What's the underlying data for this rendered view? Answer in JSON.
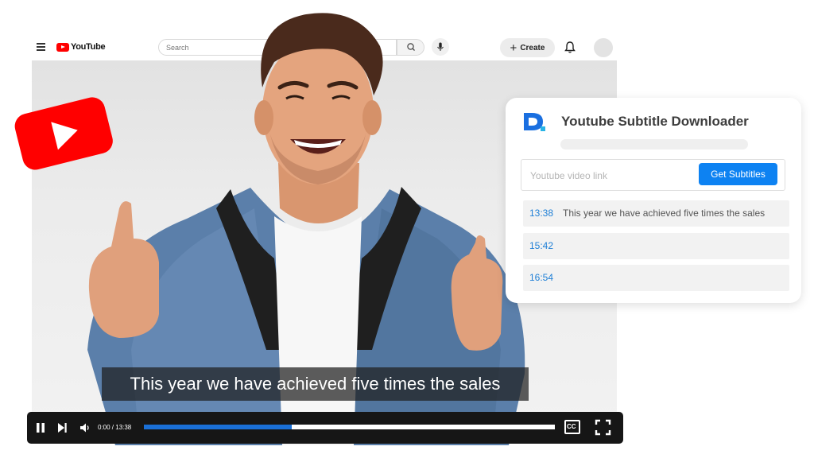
{
  "youtube": {
    "logo_text": "YouTube",
    "search": {
      "placeholder": "Search"
    },
    "create_label": "Create",
    "brand_red": "#ff0000"
  },
  "video": {
    "subtitle_text": "This year we have achieved five times the sales",
    "time": "0:00 / 13:38",
    "progress_fraction": 0.36,
    "controls": [
      "pause-icon",
      "next-icon",
      "volume-icon",
      "cc-icon",
      "fullscreen-icon"
    ],
    "cc_label": "CC"
  },
  "downloader": {
    "title": "Youtube Subtitle Downloader",
    "input_placeholder": "Youtube video link",
    "button_label": "Get Subtitles",
    "accent": "#0d82f2",
    "rows": [
      {
        "time": "13:38",
        "text": "This year we have achieved five times the sales"
      },
      {
        "time": "15:42",
        "text": ""
      },
      {
        "time": "16:54",
        "text": ""
      }
    ]
  }
}
